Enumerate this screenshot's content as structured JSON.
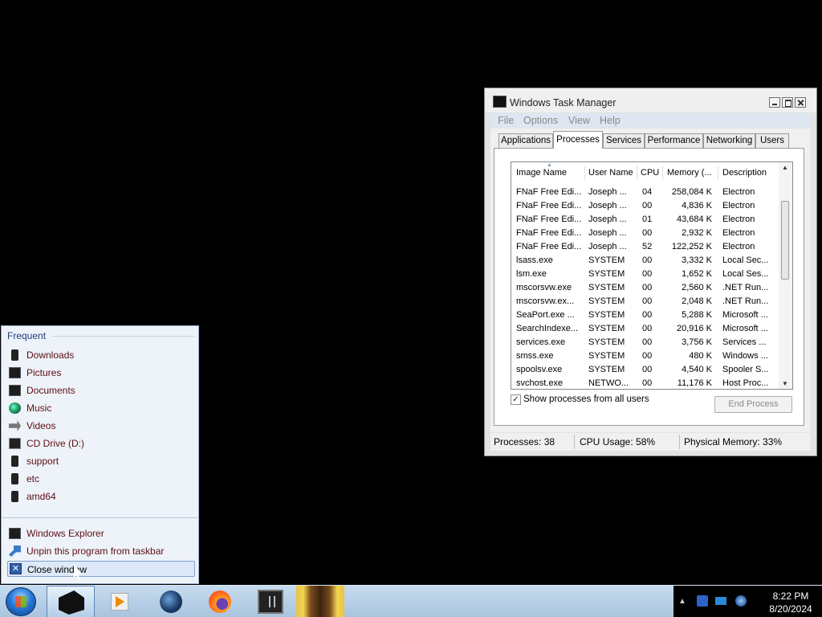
{
  "task_manager": {
    "title": "Windows Task Manager",
    "menu": [
      "File",
      "Options",
      "View",
      "Help"
    ],
    "tabs": [
      "Applications",
      "Processes",
      "Services",
      "Performance",
      "Networking",
      "Users"
    ],
    "active_tab": "Processes",
    "columns": [
      "Image Name",
      "User Name",
      "CPU",
      "Memory (...",
      "Description"
    ],
    "processes": [
      {
        "name": "FNaF Free Edi...",
        "user": "Joseph ...",
        "cpu": "04",
        "memory": "258,084 K",
        "description": "Electron"
      },
      {
        "name": "FNaF Free Edi...",
        "user": "Joseph ...",
        "cpu": "00",
        "memory": "4,836 K",
        "description": "Electron"
      },
      {
        "name": "FNaF Free Edi...",
        "user": "Joseph ...",
        "cpu": "01",
        "memory": "43,684 K",
        "description": "Electron"
      },
      {
        "name": "FNaF Free Edi...",
        "user": "Joseph ...",
        "cpu": "00",
        "memory": "2,932 K",
        "description": "Electron"
      },
      {
        "name": "FNaF Free Edi...",
        "user": "Joseph ...",
        "cpu": "52",
        "memory": "122,252 K",
        "description": "Electron"
      },
      {
        "name": "lsass.exe",
        "user": "SYSTEM",
        "cpu": "00",
        "memory": "3,332 K",
        "description": "Local Sec..."
      },
      {
        "name": "lsm.exe",
        "user": "SYSTEM",
        "cpu": "00",
        "memory": "1,652 K",
        "description": "Local Ses..."
      },
      {
        "name": "mscorsvw.exe",
        "user": "SYSTEM",
        "cpu": "00",
        "memory": "2,560 K",
        "description": ".NET Run..."
      },
      {
        "name": "mscorsvw.ex...",
        "user": "SYSTEM",
        "cpu": "00",
        "memory": "2,048 K",
        "description": ".NET Run..."
      },
      {
        "name": "SeaPort.exe ...",
        "user": "SYSTEM",
        "cpu": "00",
        "memory": "5,288 K",
        "description": "Microsoft ..."
      },
      {
        "name": "SearchIndexe...",
        "user": "SYSTEM",
        "cpu": "00",
        "memory": "20,916 K",
        "description": "Microsoft ..."
      },
      {
        "name": "services.exe",
        "user": "SYSTEM",
        "cpu": "00",
        "memory": "3,756 K",
        "description": "Services ..."
      },
      {
        "name": "smss.exe",
        "user": "SYSTEM",
        "cpu": "00",
        "memory": "480 K",
        "description": "Windows ..."
      },
      {
        "name": "spoolsv.exe",
        "user": "SYSTEM",
        "cpu": "00",
        "memory": "4,540 K",
        "description": "Spooler S..."
      },
      {
        "name": "svchost.exe",
        "user": "NETWO...",
        "cpu": "00",
        "memory": "11,176 K",
        "description": "Host Proc..."
      }
    ],
    "show_all_label": "Show processes from all users",
    "show_all_checked": "✓",
    "end_process_label": "End Process",
    "status": {
      "processes": "Processes: 38",
      "cpu": "CPU Usage: 58%",
      "memory": "Physical Memory: 33%"
    }
  },
  "jump_list": {
    "heading": "Frequent",
    "items": [
      {
        "label": "Downloads",
        "icon": "downloads-folder-icon"
      },
      {
        "label": "Pictures",
        "icon": "pictures-folder-icon"
      },
      {
        "label": "Documents",
        "icon": "documents-folder-icon"
      },
      {
        "label": "Music",
        "icon": "music-folder-icon"
      },
      {
        "label": "Videos",
        "icon": "videos-folder-icon"
      },
      {
        "label": "CD Drive (D:)",
        "icon": "cd-drive-icon"
      },
      {
        "label": "support",
        "icon": "folder-icon"
      },
      {
        "label": "etc",
        "icon": "folder-icon"
      },
      {
        "label": "amd64",
        "icon": "folder-icon"
      }
    ],
    "tasks": [
      {
        "label": "Windows Explorer",
        "icon": "windows-explorer-icon"
      },
      {
        "label": "Unpin this program from taskbar",
        "icon": "unpin-icon"
      },
      {
        "label": "Close window",
        "icon": "close-window-icon"
      }
    ]
  },
  "taskbar": {
    "time": "8:22 PM",
    "date": "8/20/2024",
    "pinned": [
      "task-manager-icon",
      "media-player-icon",
      "globe-app-icon",
      "firefox-icon",
      "terminal-icon",
      "fnaf-game-icon"
    ]
  }
}
